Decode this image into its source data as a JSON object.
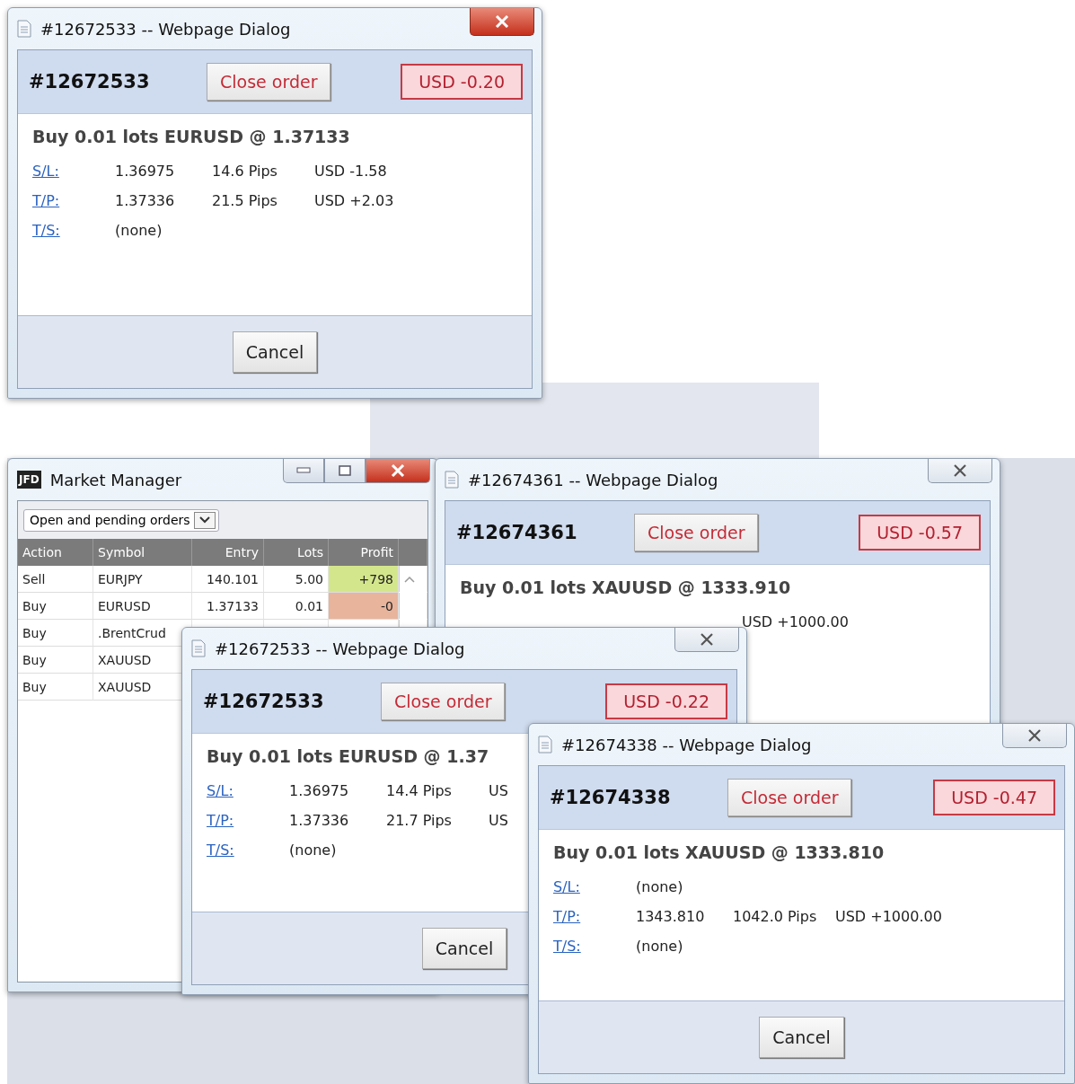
{
  "windows": [
    {
      "kind": "dialog",
      "title": "#12672533 -- Webpage Dialog",
      "active": true,
      "order_id": "#12672533",
      "close_button": "Close order",
      "pnl": "USD -0.20",
      "summary": "Buy 0.01 lots EURUSD @ 1.37133",
      "rows": [
        {
          "label": "S/L:",
          "price": "1.36975",
          "pips": "14.6 Pips",
          "usd": "USD -1.58"
        },
        {
          "label": "T/P:",
          "price": "1.37336",
          "pips": "21.5 Pips",
          "usd": "USD +2.03"
        },
        {
          "label": "T/S:",
          "price": "(none)"
        }
      ],
      "cancel": "Cancel"
    },
    {
      "kind": "market",
      "title": "Market Manager",
      "logo": "JFD",
      "active": true,
      "filter": "Open and pending orders",
      "columns": [
        "Action",
        "Symbol",
        "Entry",
        "Lots",
        "Profit"
      ],
      "rows": [
        {
          "action": "Sell",
          "symbol": "EURJPY",
          "entry": "140.101",
          "lots": "5.00",
          "profit": "+798",
          "color": "#d4e68c"
        },
        {
          "action": "Buy",
          "symbol": "EURUSD",
          "entry": "1.37133",
          "lots": "0.01",
          "profit": "-0",
          "color": "#e8b49c"
        },
        {
          "action": "Buy",
          "symbol": ".BrentCrud"
        },
        {
          "action": "Buy",
          "symbol": "XAUUSD"
        },
        {
          "action": "Buy",
          "symbol": "XAUUSD"
        }
      ]
    },
    {
      "kind": "dialog",
      "title": "#12674361 -- Webpage Dialog",
      "active": false,
      "order_id": "#12674361",
      "close_button": "Close order",
      "pnl": "USD -0.57",
      "summary": "Buy 0.01 lots XAUUSD @ 1333.910",
      "rows": [
        {
          "usd": "USD +1000.00"
        }
      ]
    },
    {
      "kind": "dialog",
      "title": "#12672533 -- Webpage Dialog",
      "active": false,
      "order_id": "#12672533",
      "close_button": "Close order",
      "pnl": "USD -0.22",
      "summary": "Buy 0.01 lots EURUSD @ 1.37",
      "rows": [
        {
          "label": "S/L:",
          "price": "1.36975",
          "pips": "14.4 Pips",
          "usd": "US"
        },
        {
          "label": "T/P:",
          "price": "1.37336",
          "pips": "21.7 Pips",
          "usd": "US"
        },
        {
          "label": "T/S:",
          "price": "(none)"
        }
      ],
      "cancel": "Cancel"
    },
    {
      "kind": "dialog",
      "title": "#12674338 -- Webpage Dialog",
      "active": false,
      "order_id": "#12674338",
      "close_button": "Close order",
      "pnl": "USD -0.47",
      "summary": "Buy 0.01 lots XAUUSD @ 1333.810",
      "rows": [
        {
          "label": "S/L:",
          "price": "(none)"
        },
        {
          "label": "T/P:",
          "price": "1343.810",
          "pips": "1042.0 Pips",
          "usd": "USD +1000.00"
        },
        {
          "label": "T/S:",
          "price": "(none)"
        }
      ],
      "cancel": "Cancel"
    }
  ]
}
